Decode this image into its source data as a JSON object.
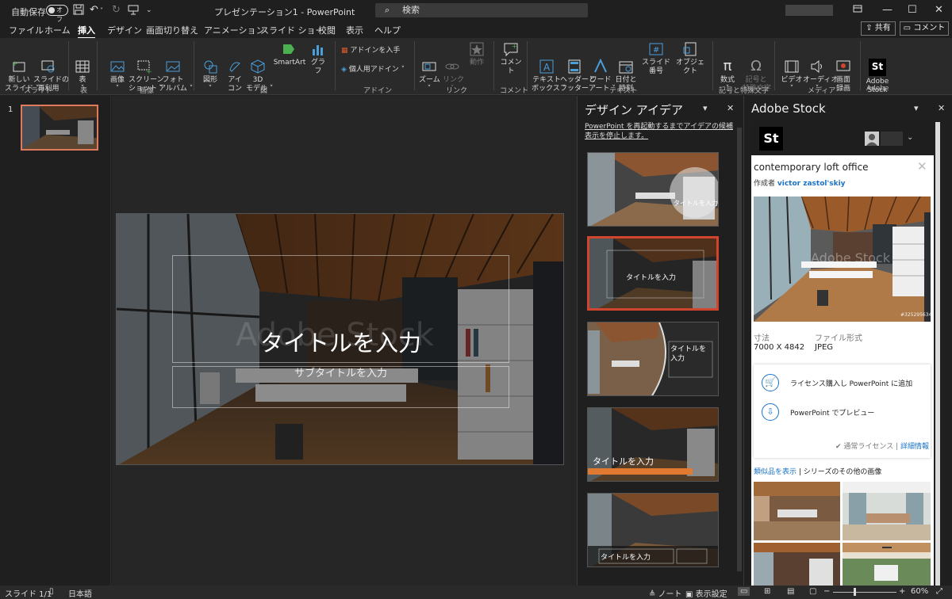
{
  "titlebar": {
    "autosave_label": "自動保存",
    "autosave_state": "オフ",
    "doc_title": "プレゼンテーション1 - PowerPoint",
    "search_placeholder": "検索"
  },
  "tabs": [
    "ファイル",
    "ホーム",
    "挿入",
    "デザイン",
    "画面切り替え",
    "アニメーション",
    "スライド ショー",
    "校閲",
    "表示",
    "ヘルプ"
  ],
  "active_tab": "挿入",
  "share_label": "共有",
  "comment_label": "コメント",
  "ribbon": {
    "new_slide": "新しい\nスライド ˅",
    "reuse_slide": "スライドの\n再利用",
    "table": "表\n˅",
    "image": "画像\n˅",
    "screenshot": "スクリーン\nショット ˅",
    "photo_album": "フォト\nアルバム ˅",
    "shapes": "図形\n˅",
    "icons": "アイ\nコン",
    "model3d": "3D\nモデル ˅",
    "smartart": "SmartArt",
    "chart": "グラフ",
    "get_addins": "アドインを入手",
    "my_addins": "個人用アドイン",
    "zoom": "ズーム\n˅",
    "link": "リンク\n˅",
    "action": "動作",
    "comment": "コメント",
    "textbox": "テキスト\nボックス ˅",
    "header_footer": "ヘッダーと\nフッター",
    "wordart": "ワード\nアート ˅",
    "datetime": "日付と\n時刻",
    "slide_number": "スライド番号",
    "object": "オブジェクト",
    "equation": "数式\n˅",
    "symbol": "記号と\n特殊文字",
    "video": "ビデオ\n˅",
    "audio": "オーディオ\n˅",
    "screen_record": "画面\n録画",
    "adobe_stock": "Adobe\nStock",
    "groups": [
      "スライド",
      "表",
      "画像",
      "図",
      "アドイン",
      "リンク",
      "コメント",
      "テキスト",
      "記号と特殊文字",
      "メディア",
      "Adobe"
    ]
  },
  "thumbnail_number": "1",
  "slide": {
    "title_placeholder": "タイトルを入力",
    "subtitle_placeholder": "サブタイトルを入力"
  },
  "design_pane": {
    "title": "デザイン アイデア",
    "stop_link": "PowerPoint を再起動するまでアイデアの候補表示を停止します。",
    "idea_title": "タイトルを入力",
    "idea_sub": "サブタイトルを入力"
  },
  "stock_pane": {
    "title": "Adobe Stock",
    "logo": "St",
    "image_name": "contemporary loft office",
    "author_label": "作成者",
    "author": "victor zastol'skiy",
    "dimension_label": "寸法",
    "dimension_value": "7000 X 4842",
    "format_label": "ファイル形式",
    "format_value": "JPEG",
    "image_id": "#325295634",
    "action_license": "ライセンス購入し PowerPoint に追加",
    "action_preview": "PowerPoint でプレビュー",
    "license_text": "通常ライセンス",
    "license_details": "詳細情報",
    "similar_link": "類似品を表示",
    "series_text": "シリーズのその他の画像"
  },
  "status": {
    "slide_count": "スライド 1/1",
    "language": "日本語",
    "notes": "ノート",
    "display_settings": "表示設定",
    "zoom": "60%"
  }
}
